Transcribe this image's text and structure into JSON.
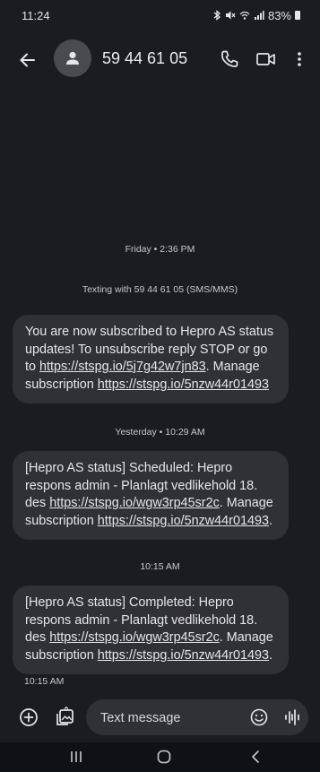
{
  "status_bar": {
    "time": "11:24",
    "icons": [
      "bluetooth-icon",
      "mute-icon",
      "wifi-calling-icon",
      "signal-icon"
    ],
    "battery_percent": "83%"
  },
  "app_bar": {
    "contact": "59 44 61 05",
    "icons": [
      "back-arrow-icon",
      "person-icon",
      "phone-icon",
      "video-icon",
      "more-vert-icon"
    ]
  },
  "conversation": {
    "date_label_1": "Friday • 2:36 PM",
    "texting_with": "Texting with 59 44 61 05 (SMS/MMS)",
    "msg1": {
      "text_1": "You are now subscribed to Hepro AS status updates! To unsubscribe reply STOP or go to ",
      "link_1": "https://stspg.io/5j7g42w7jn83",
      "text_2": ". Manage subscription ",
      "link_2": "https://stspg.io/5nzw44r01493"
    },
    "date_label_2": "Yesterday • 10:29 AM",
    "msg2": {
      "text_1": "[Hepro AS status] Scheduled: Hepro respons admin - Planlagt vedlikehold 18. des ",
      "link_1": "https://stspg.io/wgw3rp45sr2c",
      "text_2": ". Manage subscription ",
      "link_2": "https://stspg.io/5nzw44r01493",
      "text_3": "."
    },
    "date_label_3": "10:15 AM",
    "msg3": {
      "text_1": "[Hepro AS status] Completed: Hepro respons admin - Planlagt vedlikehold 18. des ",
      "link_1": "https://stspg.io/wgw3rp45sr2c",
      "text_2": ". Manage subscription ",
      "link_2": "https://stspg.io/5nzw44r01493",
      "text_3": "."
    },
    "msg3_time": "10:15 AM"
  },
  "compose": {
    "placeholder": "Text message",
    "icons": [
      "add-circle-icon",
      "gallery-icon",
      "emoji-icon",
      "voice-waveform-icon"
    ]
  },
  "nav_bar": {
    "icons": [
      "recents-icon",
      "home-icon",
      "nav-back-icon"
    ]
  },
  "colors": {
    "background": "#1b1c20",
    "bubble": "#303136",
    "text": "#e6e6ea",
    "nav": "#101114"
  }
}
